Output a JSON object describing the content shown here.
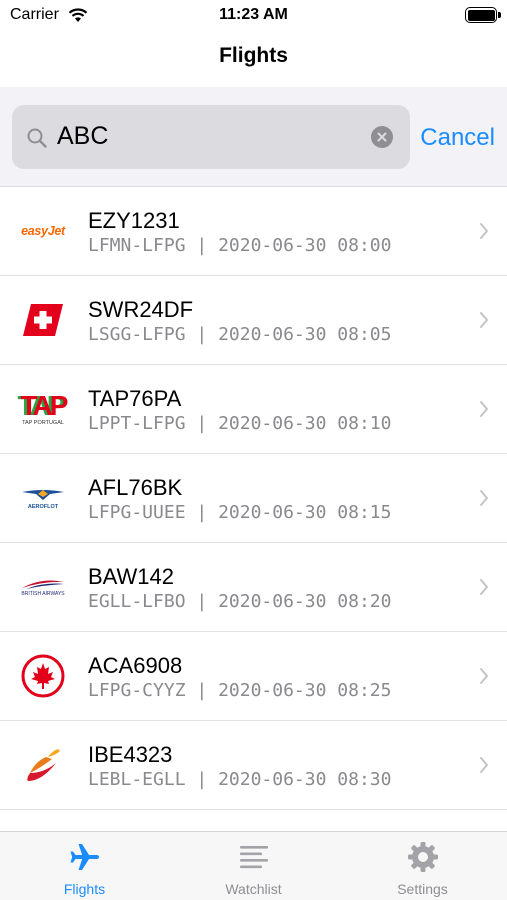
{
  "status_bar": {
    "carrier": "Carrier",
    "time": "11:23 AM"
  },
  "nav": {
    "title": "Flights"
  },
  "search": {
    "query": "ABC",
    "cancel_label": "Cancel"
  },
  "colors": {
    "accent": "#1a8cff",
    "secondary_text": "#8a8a8e"
  },
  "flights": [
    {
      "callsign": "EZY1231",
      "route": "LFMN-LFPG",
      "datetime": "2020-06-30 08:00",
      "airline_logo": "easyjet-logo",
      "logo_text": "easyJet"
    },
    {
      "callsign": "SWR24DF",
      "route": "LSGG-LFPG",
      "datetime": "2020-06-30 08:05",
      "airline_logo": "swiss-logo"
    },
    {
      "callsign": "TAP76PA",
      "route": "LPPT-LFPG",
      "datetime": "2020-06-30 08:10",
      "airline_logo": "tap-logo",
      "logo_text": "TAP",
      "logo_subtext": "TAP PORTUGAL"
    },
    {
      "callsign": "AFL76BK",
      "route": "LFPG-UUEE",
      "datetime": "2020-06-30 08:15",
      "airline_logo": "aeroflot-logo",
      "logo_text": "AEROFLOT"
    },
    {
      "callsign": "BAW142",
      "route": "EGLL-LFBO",
      "datetime": "2020-06-30 08:20",
      "airline_logo": "british-airways-logo",
      "logo_text": "BRITISH AIRWAYS"
    },
    {
      "callsign": "ACA6908",
      "route": "LFPG-CYYZ",
      "datetime": "2020-06-30 08:25",
      "airline_logo": "air-canada-logo"
    },
    {
      "callsign": "IBE4323",
      "route": "LEBL-EGLL",
      "datetime": "2020-06-30 08:30",
      "airline_logo": "iberia-logo"
    }
  ],
  "tabs": [
    {
      "label": "Flights",
      "icon": "airplane-icon",
      "active": true
    },
    {
      "label": "Watchlist",
      "icon": "list-icon",
      "active": false
    },
    {
      "label": "Settings",
      "icon": "gear-icon",
      "active": false
    }
  ]
}
